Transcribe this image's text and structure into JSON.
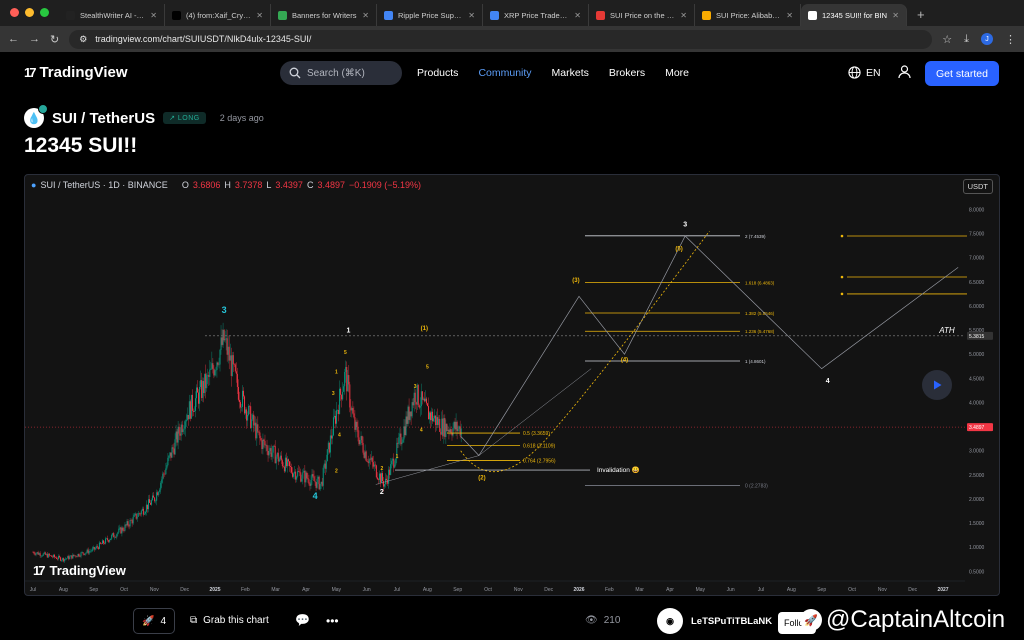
{
  "browser": {
    "tabs": [
      {
        "title": "StealthWriter AI - Ga",
        "color": "#222222",
        "active": false
      },
      {
        "title": "(4) from:Xaif_Crypto",
        "color": "#000000",
        "active": false
      },
      {
        "title": "Banners for Writers",
        "color": "#34a853",
        "active": false
      },
      {
        "title": "Ripple Price Suppor",
        "color": "#4285f4",
        "active": false
      },
      {
        "title": "XRP Price Trades Ab",
        "color": "#4285f4",
        "active": false
      },
      {
        "title": "SUI Price on the Bri",
        "color": "#e53935",
        "active": false
      },
      {
        "title": "SUI Price: Alibaba P",
        "color": "#f9ab00",
        "active": false
      },
      {
        "title": "12345 SUI!! for BIN",
        "color": "#ffffff",
        "active": true
      }
    ],
    "url": "tradingview.com/chart/SUIUSDT/NlkD4ulx-12345-SUI/",
    "profile_initial": "J"
  },
  "site": {
    "logo": "TradingView",
    "search_placeholder": "Search (⌘K)",
    "menu": [
      "Products",
      "Community",
      "Markets",
      "Brokers",
      "More"
    ],
    "active_menu": "Community",
    "lang": "EN",
    "get_started": "Get started"
  },
  "idea": {
    "symbol": "SUI / TetherUS",
    "badge": "↗ LONG",
    "posted": "2 days ago",
    "title": "12345 SUI!!"
  },
  "chart_data": {
    "type": "candlestick",
    "legend": {
      "symbol": "SUI / TetherUS · 1D · BINANCE",
      "O": "3.6806",
      "H": "3.7378",
      "L": "3.4397",
      "C": "3.4897",
      "change": "−0.1909 (−5.19%)"
    },
    "currency": "USDT",
    "y_ticks": [
      "8.0000",
      "7.5000",
      "7.0000",
      "6.5000",
      "6.0000",
      "5.5000",
      "5.0000",
      "4.5000",
      "4.0000",
      "3.5000",
      "3.0000",
      "2.5000",
      "2.0000",
      "1.5000",
      "1.0000",
      "0.5000"
    ],
    "x_ticks": [
      "Jul",
      "Aug",
      "Sep",
      "Oct",
      "Nov",
      "Dec",
      "2025",
      "Feb",
      "Mar",
      "Apr",
      "May",
      "Jun",
      "Jul",
      "Aug",
      "Sep",
      "Oct",
      "Nov",
      "Dec",
      "2026",
      "Feb",
      "Mar",
      "Apr",
      "May",
      "Jun",
      "Jul",
      "Aug",
      "Sep",
      "Oct",
      "Nov",
      "Dec",
      "2027"
    ],
    "ylim": [
      0.3,
      8.3
    ],
    "current_price": "3.4897",
    "ath_label": "ATH",
    "ath_price": "5.3815",
    "fib_retracement": [
      {
        "label": "0.5 (3.3659)",
        "value": 3.3659
      },
      {
        "label": "0.618 (3.1109)",
        "value": 3.1109
      },
      {
        "label": "0.764 (2.7956)",
        "value": 2.7956
      },
      {
        "label": "0 (2.2783)",
        "value": 2.2783
      }
    ],
    "fib_extension": [
      {
        "label": "2 (7.4539)",
        "value": 7.4539
      },
      {
        "label": "1.618 (6.4863)",
        "value": 6.4863
      },
      {
        "label": "1.382 (5.8546)",
        "value": 5.8546
      },
      {
        "label": "1.236 (5.4768)",
        "value": 5.4768
      },
      {
        "label": "1 (4.8601)",
        "value": 4.8601
      }
    ],
    "invalidation_label": "Invalidation 😀",
    "invalidation_price": 2.6,
    "wave_labels": [
      "3",
      "4",
      "1",
      "2",
      "3",
      "4",
      "5",
      "1",
      "2",
      "3",
      "4",
      "5",
      "1",
      "2",
      "(1)",
      "(2)",
      "(3)",
      "(4)",
      "(5)",
      "3",
      "4"
    ],
    "watermark": "TradingView"
  },
  "footer": {
    "boosts": "4",
    "grab": "Grab this chart",
    "views": "210",
    "author": "LeTSPuTiTBLaNK",
    "follow": "Follow",
    "brand": "@CaptainAltcoin"
  }
}
